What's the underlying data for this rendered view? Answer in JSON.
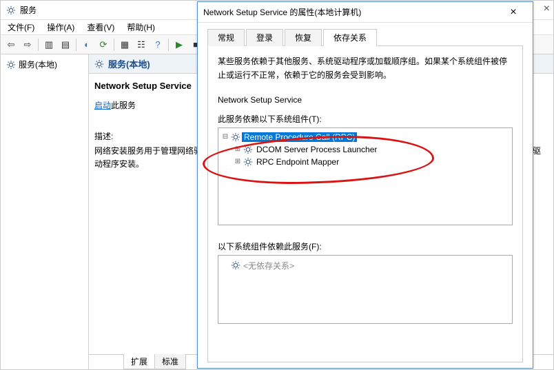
{
  "main_window": {
    "title": "服务",
    "menu": {
      "file": "文件(F)",
      "action": "操作(A)",
      "view": "查看(V)",
      "help": "帮助(H)"
    }
  },
  "left_pane": {
    "root": "服务(本地)"
  },
  "center": {
    "header": "服务(本地)",
    "service_name": "Network Setup Service",
    "start_link": "启动",
    "start_suffix": "此服务",
    "desc_label": "描述:",
    "desc_text": "网络安装服务用于管理网络驱动程序的安装，并允许配置低级别网络设置。如果停止此服务，可能会取消正在进行的所有驱动程序安装。",
    "tabs": {
      "ext": "扩展",
      "std": "标准"
    }
  },
  "dialog": {
    "title": "Network Setup Service 的属性(本地计算机)",
    "tabs": {
      "general": "常规",
      "logon": "登录",
      "recovery": "恢复",
      "deps": "依存关系"
    },
    "info_text": "某些服务依赖于其他服务、系统驱动程序或加载顺序组。如果某个系统组件被停止或运行不正常，依赖于它的服务会受到影响。",
    "service_name": "Network Setup Service",
    "depends_on_label": "此服务依赖以下系统组件(T):",
    "tree": {
      "root": "Remote Procedure Call (RPC)",
      "child1": "DCOM Server Process Launcher",
      "child2": "RPC Endpoint Mapper"
    },
    "depended_by_label": "以下系统组件依赖此服务(F):",
    "no_dep": "<无依存关系>"
  }
}
